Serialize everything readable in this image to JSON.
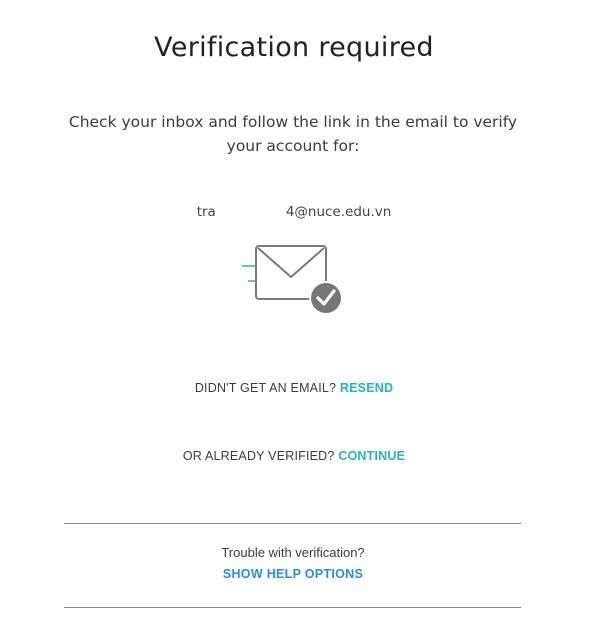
{
  "page": {
    "title": "Verification required",
    "description": "Check your inbox and follow the link in the email to verify your account for:",
    "email_prefix": "tra",
    "email_suffix": "4@nuce.edu.vn"
  },
  "icons": {
    "envelope": "envelope-check-icon"
  },
  "actions": {
    "resend_prompt": "DIDN'T GET AN EMAIL?",
    "resend_label": "RESEND",
    "continue_prompt": "OR ALREADY VERIFIED?",
    "continue_label": "CONTINUE"
  },
  "help": {
    "prompt": "Trouble with verification?",
    "link_label": "SHOW HELP OPTIONS"
  },
  "colors": {
    "accent_teal": "#2bb5b0",
    "link_blue": "#2a8fd6",
    "icon_gray": "#7a7a7a"
  }
}
